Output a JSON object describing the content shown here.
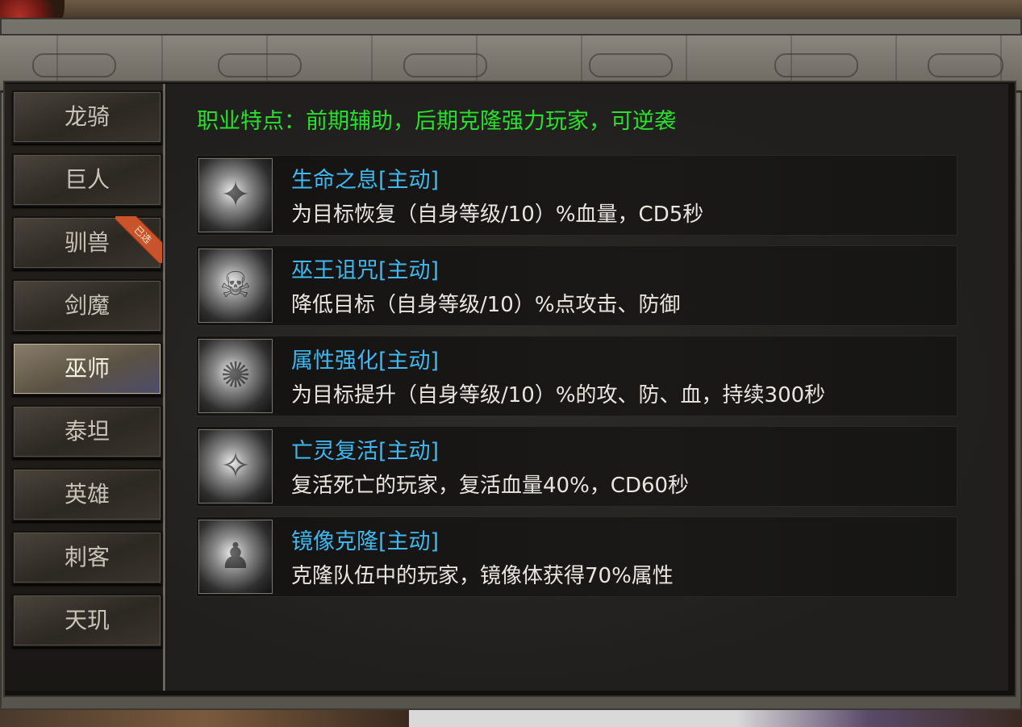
{
  "sidebar": {
    "tabs": [
      {
        "label": "龙骑",
        "active": false
      },
      {
        "label": "巨人",
        "active": false
      },
      {
        "label": "驯兽",
        "active": false,
        "badge": "已选"
      },
      {
        "label": "剑魔",
        "active": false
      },
      {
        "label": "巫师",
        "active": true
      },
      {
        "label": "泰坦",
        "active": false
      },
      {
        "label": "英雄",
        "active": false
      },
      {
        "label": "刺客",
        "active": false
      },
      {
        "label": "天玑",
        "active": false
      }
    ]
  },
  "main": {
    "feature": "职业特点：前期辅助，后期克隆强力玩家，可逆袭",
    "skills": [
      {
        "name": "生命之息[主动]",
        "desc": "为目标恢复（自身等级/10）%血量，CD5秒",
        "icon": "life-breath-icon"
      },
      {
        "name": "巫王诅咒[主动]",
        "desc": "降低目标（自身等级/10）%点攻击、防御",
        "icon": "witch-king-curse-icon"
      },
      {
        "name": "属性强化[主动]",
        "desc": "为目标提升（自身等级/10）%的攻、防、血，持续300秒",
        "icon": "attribute-boost-icon"
      },
      {
        "name": "亡灵复活[主动]",
        "desc": "复活死亡的玩家，复活血量40%，CD60秒",
        "icon": "undead-revive-icon"
      },
      {
        "name": "镜像克隆[主动]",
        "desc": "克隆队伍中的玩家，镜像体获得70%属性",
        "icon": "mirror-clone-icon"
      }
    ]
  },
  "colors": {
    "feature_text": "#28e02c",
    "skill_name": "#3fb8f0",
    "skill_desc": "#e9e6e0",
    "tab_text": "#c9c2b6",
    "badge": "#c9542c"
  }
}
